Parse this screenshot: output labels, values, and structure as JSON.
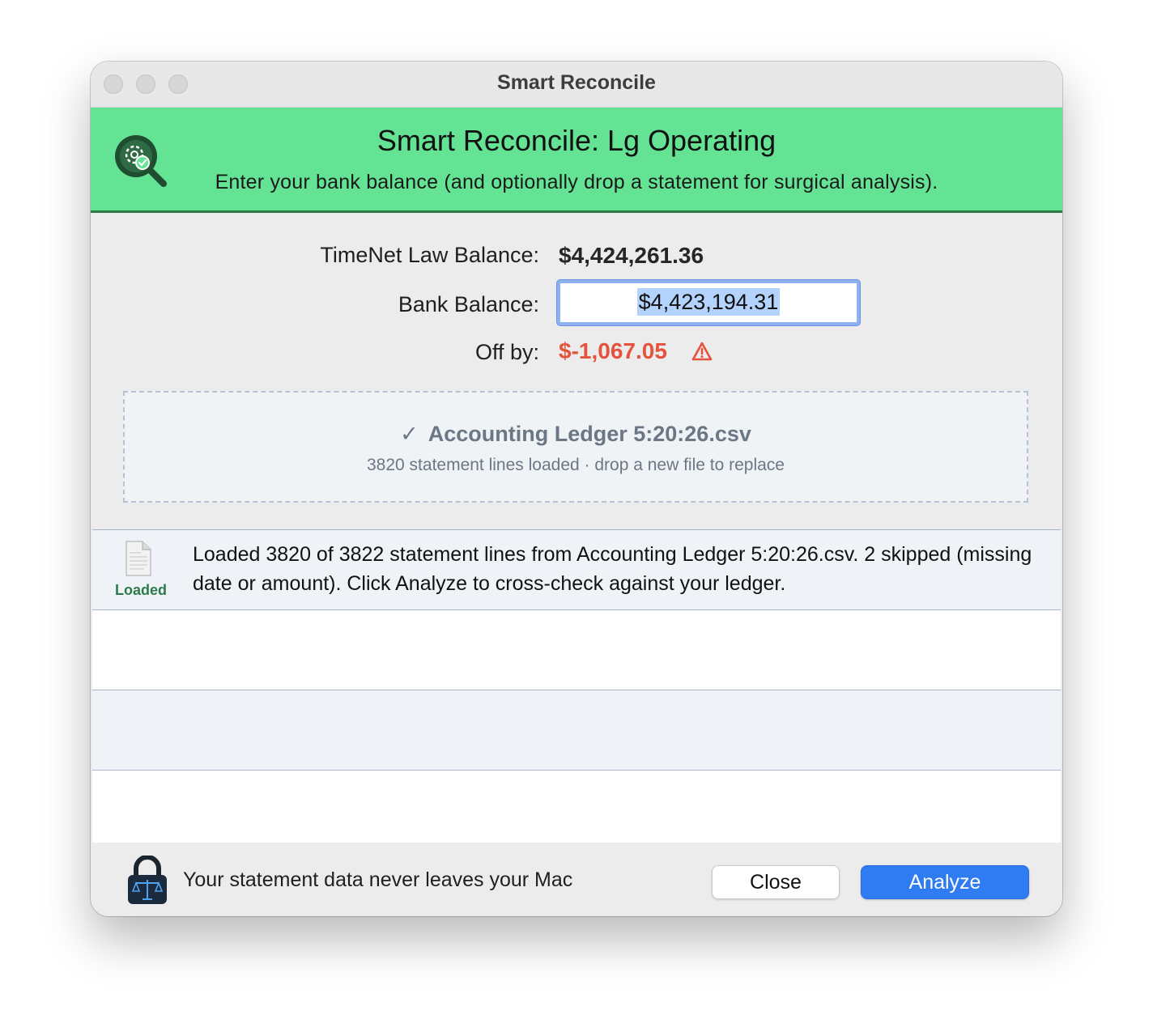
{
  "window": {
    "title": "Smart Reconcile"
  },
  "banner": {
    "icon": "magnifier-gear-check-icon",
    "title": "Smart Reconcile: Lg Operating",
    "subtitle": "Enter your bank balance (and optionally drop a statement for surgical analysis)."
  },
  "balances": {
    "ledger_label": "TimeNet Law Balance:",
    "ledger_value": "$4,424,261.36",
    "bank_label": "Bank Balance:",
    "bank_value": "$4,423,194.31",
    "off_label": "Off by:",
    "off_value": "$-1,067.05",
    "off_icon": "warning-triangle-icon",
    "off_color": "#e5533d"
  },
  "dropzone": {
    "check": "✓",
    "file_name": "Accounting Ledger 5:20:26.csv",
    "detail": "3820 statement lines loaded · drop a new file to replace"
  },
  "results": [
    {
      "status": "Loaded",
      "icon": "document-icon",
      "message": "Loaded 3820 of 3822 statement lines from Accounting Ledger 5:20:26.csv. 2 skipped (missing date or amount).  Click Analyze to cross-check against your ledger."
    }
  ],
  "footer": {
    "icon": "lock-scales-icon",
    "privacy_text": "Your statement data never leaves your Mac",
    "close_label": "Close",
    "analyze_label": "Analyze"
  },
  "colors": {
    "banner": "#65e394",
    "accent": "#2f7bf2",
    "status_ok": "#2f7a4b"
  }
}
